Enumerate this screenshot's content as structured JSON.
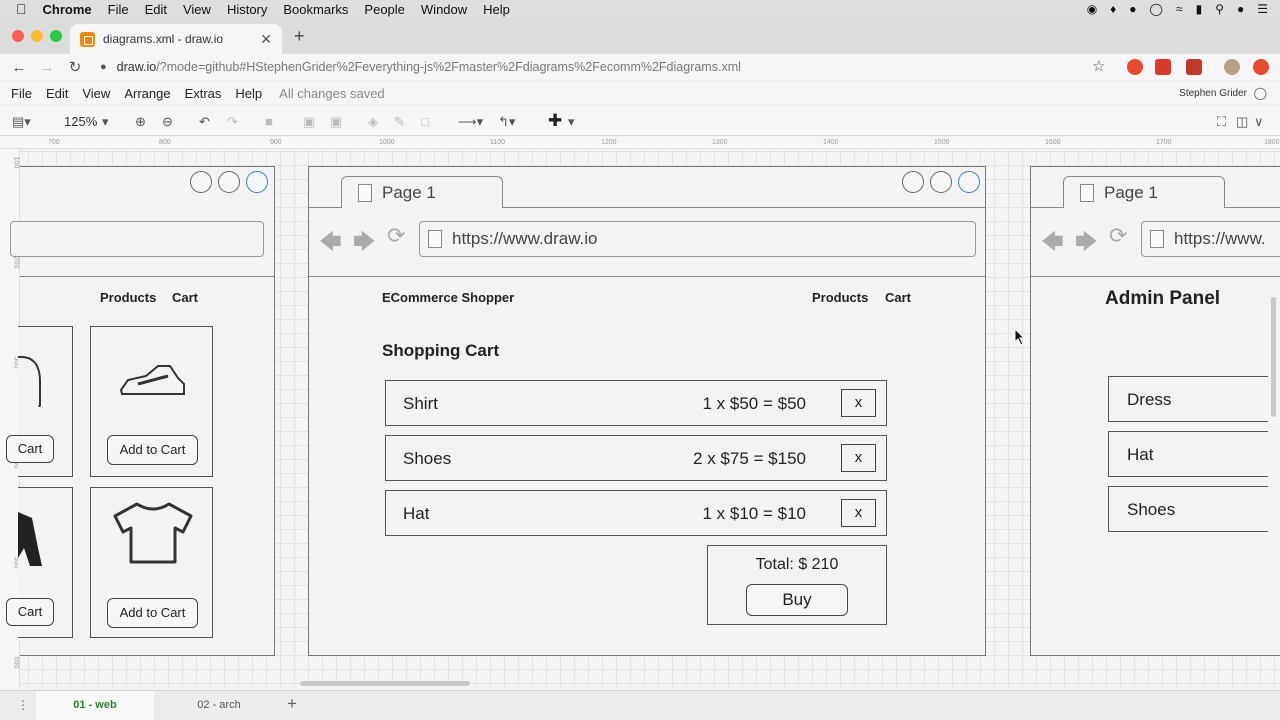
{
  "mac_menu": {
    "app": "Chrome",
    "items": [
      "File",
      "Edit",
      "View",
      "History",
      "Bookmarks",
      "People",
      "Window",
      "Help"
    ]
  },
  "browser": {
    "tab_title": "diagrams.xml - draw.io",
    "url_host": "draw.io",
    "url_rest": "/?mode=github#HStephenGrider%2Feverything-js%2Fmaster%2Fdiagrams%2Fecomm%2Fdiagrams.xml"
  },
  "app_menu": {
    "items": [
      "File",
      "Edit",
      "View",
      "Arrange",
      "Extras",
      "Help"
    ],
    "status": "All changes saved",
    "user": "Stephen Grider"
  },
  "toolbar": {
    "zoom": "125%"
  },
  "ruler": {
    "top": [
      "700",
      "800",
      "900",
      "1000",
      "1100",
      "1200",
      "1300",
      "1400",
      "1500",
      "1600",
      "1700",
      "1800"
    ],
    "left": [
      "100",
      "200",
      "300",
      "400",
      "500",
      "600"
    ]
  },
  "left_frame": {
    "nav": [
      "Products",
      "Cart"
    ],
    "add_to_cart": "Add to Cart",
    "cart_short": "Cart"
  },
  "center_frame": {
    "tab": "Page 1",
    "url": "https://www.draw.io",
    "brand": "ECommerce Shopper",
    "nav": [
      "Products",
      "Cart"
    ],
    "heading": "Shopping Cart",
    "items": [
      {
        "name": "Shirt",
        "price": "1 x $50 = $50",
        "remove": "x"
      },
      {
        "name": "Shoes",
        "price": "2 x $75 = $150",
        "remove": "x"
      },
      {
        "name": "Hat",
        "price": "1 x $10 = $10",
        "remove": "x"
      }
    ],
    "total": "Total: $ 210",
    "buy": "Buy"
  },
  "right_frame": {
    "tab": "Page 1",
    "url": "https://www.",
    "heading": "Admin Panel",
    "items": [
      "Dress",
      "Hat",
      "Shoes"
    ]
  },
  "pages": [
    "01 - web",
    "02 - arch"
  ],
  "colors": {
    "accent": "#3b7fd9",
    "active_page": "#2e7d32",
    "drawio": "#f08705"
  }
}
